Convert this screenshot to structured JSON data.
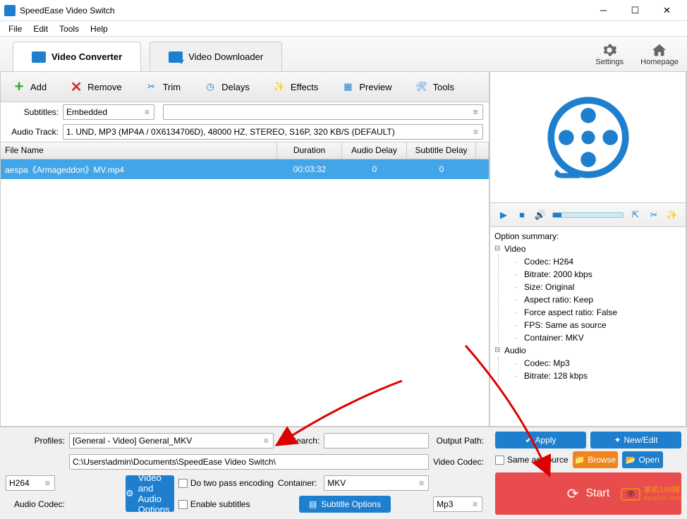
{
  "window": {
    "title": "SpeedEase Video Switch"
  },
  "menu": {
    "file": "File",
    "edit": "Edit",
    "tools": "Tools",
    "help": "Help"
  },
  "tabs": {
    "converter": "Video Converter",
    "downloader": "Video Downloader"
  },
  "header_buttons": {
    "settings": "Settings",
    "homepage": "Homepage"
  },
  "toolbar": {
    "add": "Add",
    "remove": "Remove",
    "trim": "Trim",
    "delays": "Delays",
    "effects": "Effects",
    "preview": "Preview",
    "tools": "Tools"
  },
  "subtitles": {
    "label": "Subtitles:",
    "value": "Embedded"
  },
  "audiotrack": {
    "label": "Audio Track:",
    "value": "1. UND, MP3 (MP4A / 0X6134706D), 48000 HZ, STEREO, S16P, 320 KB/S (DEFAULT)"
  },
  "columns": {
    "name": "File Name",
    "duration": "Duration",
    "audio_delay": "Audio Delay",
    "subtitle_delay": "Subtitle Delay"
  },
  "rows": [
    {
      "name": "aespa《Armageddon》MV.mp4",
      "duration": "00:03:32",
      "audio_delay": "0",
      "subtitle_delay": "0"
    }
  ],
  "option_summary": {
    "title": "Option summary:",
    "video_label": "Video",
    "video": {
      "codec": "Codec: H264",
      "bitrate": "Bitrate: 2000 kbps",
      "size": "Size:  Original",
      "aspect": "Aspect ratio: Keep",
      "force_aspect": "Force aspect ratio: False",
      "fps": "FPS: Same as source",
      "container": "Container: MKV"
    },
    "audio_label": "Audio",
    "audio": {
      "codec": "Codec: Mp3",
      "bitrate": "Bitrate: 128 kbps"
    }
  },
  "bottom": {
    "profiles_label": "Profiles:",
    "profiles_value": "[General - Video] General_MKV",
    "search_label": "Search:",
    "output_path_label": "Output Path:",
    "output_path_value": "C:\\Users\\admin\\Documents\\SpeedEase Video Switch\\",
    "video_codec_label": "Video Codec:",
    "video_codec_value": "H264",
    "audio_codec_label": "Audio Codec:",
    "audio_codec_value": "Mp3",
    "vao_button": "Video and Audio Options",
    "two_pass": "Do two pass encoding",
    "enable_subs": "Enable subtitles",
    "container_label": "Container:",
    "container_value": "MKV",
    "subtitle_options": "Subtitle Options",
    "apply": "Apply",
    "new_edit": "New/Edit",
    "same_as_source": "Same as source",
    "browse": "Browse",
    "open": "Open",
    "start": "Start"
  },
  "watermark": {
    "cn": "单机100网",
    "url": "danji100.com"
  }
}
